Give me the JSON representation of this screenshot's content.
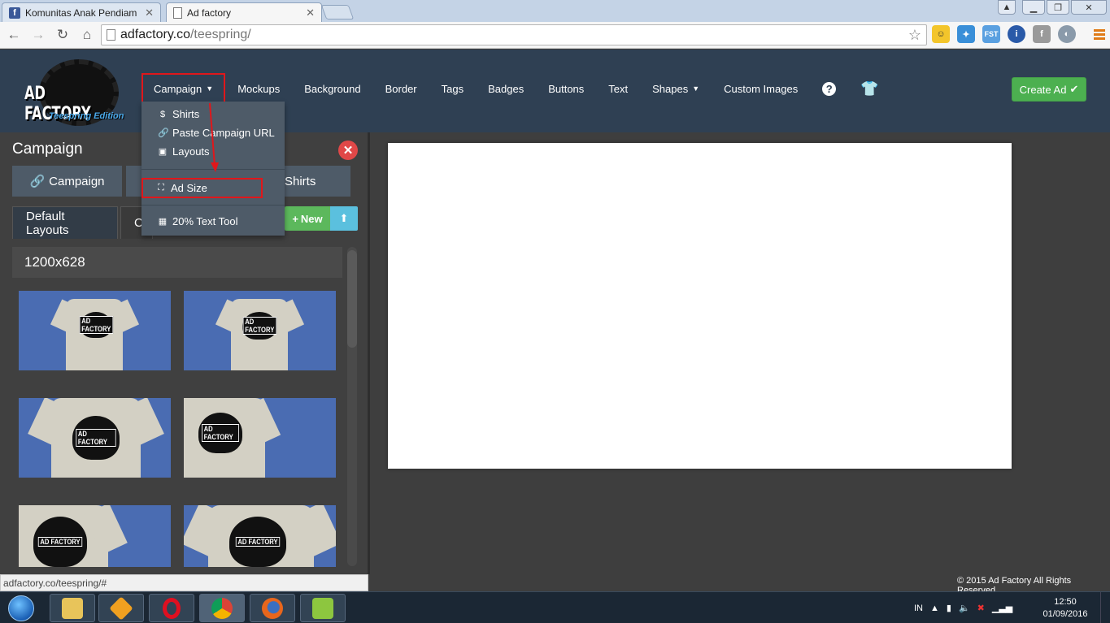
{
  "browser": {
    "tabs": [
      {
        "title": "Komunitas Anak Pendiam",
        "active": false,
        "favicon": "facebook-icon"
      },
      {
        "title": "Ad factory",
        "active": true,
        "favicon": "page-icon"
      }
    ],
    "url_host": "adfactory.co",
    "url_path": "/teespring/",
    "status_url": "adfactory.co/teespring/#"
  },
  "app": {
    "logo_text": "AD FACTORY",
    "logo_subtitle": "Teespring Edition",
    "nav": {
      "campaign": "Campaign",
      "mockups": "Mockups",
      "background": "Background",
      "border": "Border",
      "tags": "Tags",
      "badges": "Badges",
      "buttons": "Buttons",
      "text": "Text",
      "shapes": "Shapes",
      "custom_images": "Custom Images"
    },
    "create_ad": "Create Ad",
    "dropdown": {
      "shirts": "Shirts",
      "paste_url": "Paste Campaign URL",
      "layouts": "Layouts",
      "ad_size": "Ad Size",
      "text_tool": "20% Text Tool"
    },
    "panel": {
      "title": "Campaign",
      "tab_campaign": "Campaign",
      "tab_shirts": "Shirts",
      "subtab_default": "Default Layouts",
      "subtab_other": "C",
      "new_label": "New",
      "size_label": "1200x628",
      "thumb_label": "AD FACTORY"
    },
    "copyright": "© 2015 Ad Factory All Rights Reserved"
  },
  "taskbar": {
    "language": "IN",
    "time": "12:50",
    "date": "01/09/2016"
  },
  "colors": {
    "header_bg": "#2f4053",
    "create_green": "#4cb050",
    "highlight_red": "#e0171b",
    "thumb_blue": "#4a6cb2"
  }
}
